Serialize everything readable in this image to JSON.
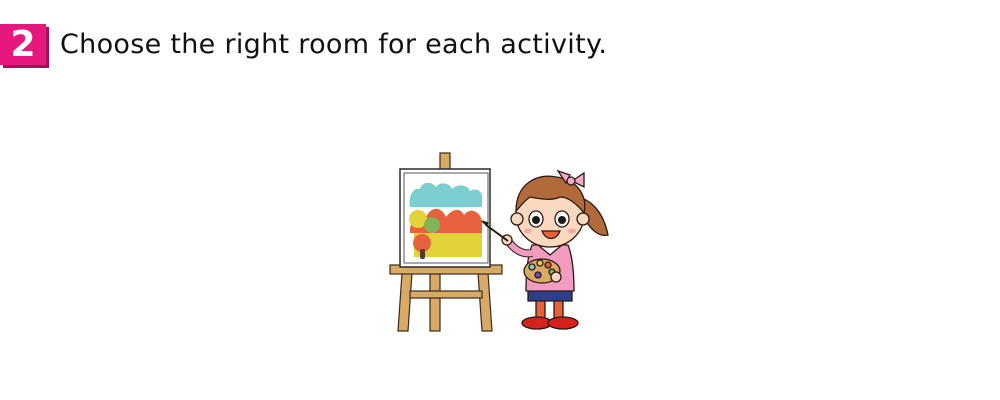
{
  "question": {
    "number": "2",
    "instruction": "Choose the right room for each activity."
  },
  "illustration": {
    "subject": "girl-painting-at-easel",
    "colors": {
      "accent": "#e4187d",
      "wood": "#d9aa66",
      "sky": "#7ccfd0",
      "hills": "#e8613d",
      "field": "#e3d23a",
      "shirt": "#f49cc0",
      "shorts": "#2b3f8e",
      "shoes": "#d8201c",
      "hair": "#b36a3a",
      "bow": "#f6a8c8"
    }
  }
}
